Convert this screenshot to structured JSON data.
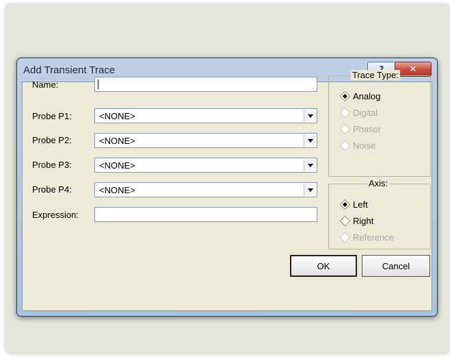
{
  "window": {
    "title": "Add Transient Trace",
    "help_glyph": "?",
    "close_glyph": "✕"
  },
  "form": {
    "name_label": "Name:",
    "name_value": "",
    "probes": [
      {
        "label": "Probe P1:",
        "value": "<NONE>"
      },
      {
        "label": "Probe P2:",
        "value": "<NONE>"
      },
      {
        "label": "Probe P3:",
        "value": "<NONE>"
      },
      {
        "label": "Probe P4:",
        "value": "<NONE>"
      }
    ],
    "expression_label": "Expression:",
    "expression_value": ""
  },
  "trace_type": {
    "legend": "Trace Type:",
    "options": [
      {
        "label": "Analog",
        "selected": true,
        "enabled": true
      },
      {
        "label": "Digital",
        "selected": false,
        "enabled": false
      },
      {
        "label": "Phasor",
        "selected": false,
        "enabled": false
      },
      {
        "label": "Noise",
        "selected": false,
        "enabled": false
      }
    ]
  },
  "axis": {
    "legend": "Axis:",
    "options": [
      {
        "label": "Left",
        "selected": true,
        "enabled": true
      },
      {
        "label": "Right",
        "selected": false,
        "enabled": true
      },
      {
        "label": "Reference",
        "selected": false,
        "enabled": false
      }
    ]
  },
  "buttons": {
    "ok": "OK",
    "cancel": "Cancel"
  },
  "icons": [
    "help-icon",
    "close-icon",
    "dropdown-arrow-icon",
    "radio-diamond-icon"
  ]
}
